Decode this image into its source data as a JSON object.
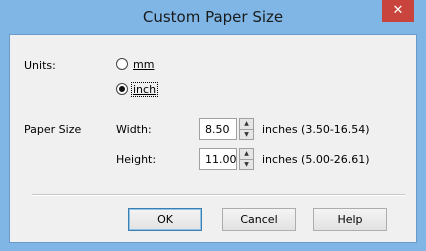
{
  "window": {
    "title": "Custom Paper Size",
    "close_label": "✕"
  },
  "units": {
    "label": "Units:",
    "options": [
      {
        "label": "mm",
        "checked": false
      },
      {
        "label": "inch",
        "checked": true
      }
    ]
  },
  "paper_size": {
    "label": "Paper Size",
    "width": {
      "label": "Width:",
      "value": "8.50",
      "range": "inches (3.50-16.54)"
    },
    "height": {
      "label": "Height:",
      "value": "11.00",
      "range": "inches (5.00-26.61)"
    }
  },
  "buttons": {
    "ok": "OK",
    "cancel": "Cancel",
    "help": "Help"
  },
  "spin": {
    "up": "▲",
    "down": "▼"
  },
  "colors": {
    "titlebar": "#7fb6e6",
    "close": "#c9443d",
    "client": "#f0f0f0"
  }
}
